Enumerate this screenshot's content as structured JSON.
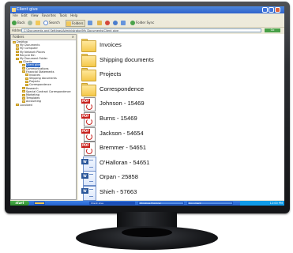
{
  "window": {
    "title": "Client give",
    "menu": [
      "File",
      "Edit",
      "View",
      "Favorites",
      "Tools",
      "Help"
    ],
    "toolbar": {
      "back": "Back",
      "search": "Search",
      "folders": "Folders",
      "folder_sync": "Folder Sync"
    },
    "address_label": "Address",
    "address_value": "C:\\Documents and Settings\\Administrator\\My Documents\\Client give",
    "go": "Go"
  },
  "folders_pane": {
    "header": "Folders",
    "close": "×",
    "items": [
      {
        "label": "Desktop"
      },
      {
        "label": "My Documents"
      },
      {
        "label": "My Computer"
      },
      {
        "label": "My Network Places"
      },
      {
        "label": "Recycle Bin"
      },
      {
        "label": "My Document Folder"
      },
      {
        "label": "Clients"
      },
      {
        "label": "Client give"
      },
      {
        "label": "Communications"
      },
      {
        "label": "Financial Statements"
      },
      {
        "label": "Invoices"
      },
      {
        "label": "Shipping documents"
      },
      {
        "label": "Projects"
      },
      {
        "label": "Correspondence"
      },
      {
        "label": "Research"
      },
      {
        "label": "Special Contract Correspondence"
      },
      {
        "label": "Marketing"
      },
      {
        "label": "Templates"
      },
      {
        "label": "Accounting"
      },
      {
        "label": "Localized"
      }
    ]
  },
  "files": [
    {
      "name": "Invoices",
      "type": "folder"
    },
    {
      "name": "Shipping documents",
      "type": "folder"
    },
    {
      "name": "Projects",
      "type": "folder"
    },
    {
      "name": "Correspondence",
      "type": "folder"
    },
    {
      "name": "Johnson - 15469",
      "type": "pdf"
    },
    {
      "name": "Burns - 15469",
      "type": "pdf"
    },
    {
      "name": "Jackson - 54654",
      "type": "pdf"
    },
    {
      "name": "Bremmer - 54651",
      "type": "pdf"
    },
    {
      "name": "O'Halloran - 54651",
      "type": "word"
    },
    {
      "name": "Orpan - 25858",
      "type": "word"
    },
    {
      "name": "Shieh - 57663",
      "type": "word"
    }
  ],
  "icon_labels": {
    "pdf": "PDF",
    "word": "W"
  },
  "taskbar": {
    "start": "start",
    "tasks": [
      "Client give",
      "Windows Explorer",
      "Document"
    ],
    "clock": "12:00 PM"
  }
}
